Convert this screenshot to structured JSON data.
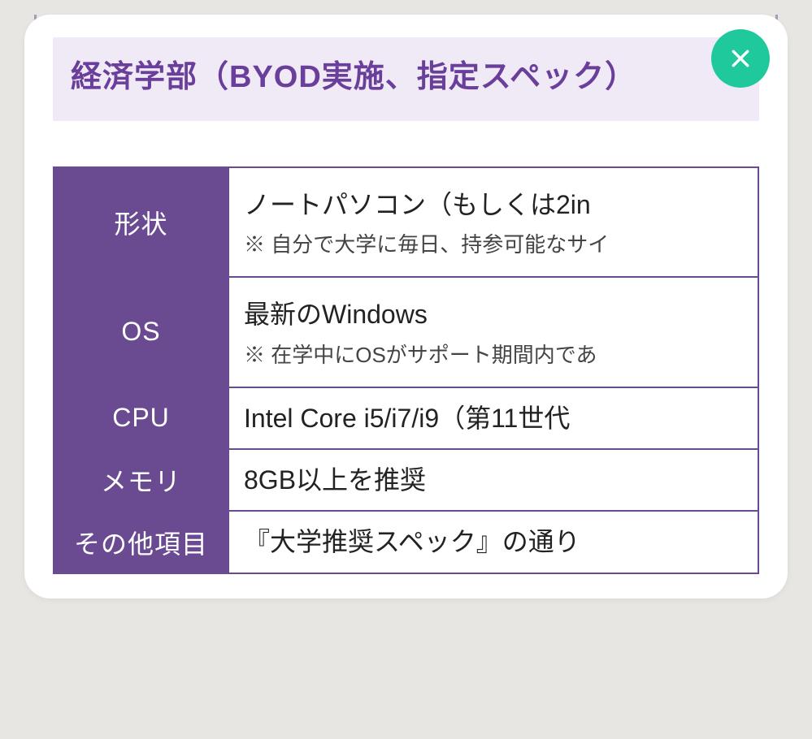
{
  "title": "経済学部（BYOD実施、指定スペック）",
  "specs": [
    {
      "label": "形状",
      "value": "ノートパソコン（もしくは2in",
      "note": "※ 自分で大学に毎日、持参可能なサイ"
    },
    {
      "label": "OS",
      "value": "最新のWindows",
      "note": "※ 在学中にOSがサポート期間内であ"
    },
    {
      "label": "CPU",
      "value": "Intel Core i5/i7/i9（第11世代"
    },
    {
      "label": "メモリ",
      "value": "8GB以上を推奨"
    },
    {
      "label": "その他項目",
      "value": "『大学推奨スペック』の通り"
    }
  ]
}
